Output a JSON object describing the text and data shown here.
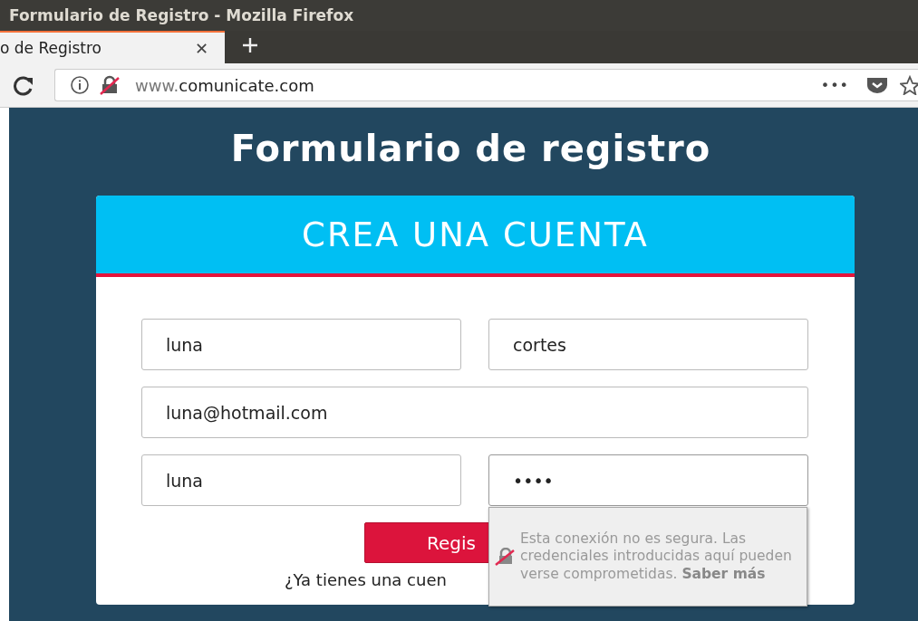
{
  "window": {
    "title": "Formulario de Registro - Mozilla Firefox"
  },
  "tabs": [
    {
      "label": "o de Registro",
      "selected": true,
      "close": "✕"
    }
  ],
  "toolbar": {
    "url_prefix": "www.",
    "url_domain": "comunicate.com",
    "more": "•••"
  },
  "page": {
    "heading": "Formulario de registro",
    "card": {
      "title": "CREA UNA CUENTA",
      "fields": [
        {
          "value": "luna",
          "kind": "half",
          "focused": false
        },
        {
          "value": "cortes",
          "kind": "half",
          "focused": false
        },
        {
          "value": "luna@hotmail.com",
          "kind": "full",
          "focused": false
        },
        {
          "value": "luna",
          "kind": "half",
          "focused": false
        },
        {
          "value": "••••",
          "kind": "half",
          "focused": true
        }
      ],
      "button": "Regis",
      "login_text": "¿Ya tienes una cuen"
    }
  },
  "popup": {
    "text": "Esta conexión no es segura. Las credenciales introducidas aquí pueden verse comprometidas.",
    "link": "Saber más"
  }
}
